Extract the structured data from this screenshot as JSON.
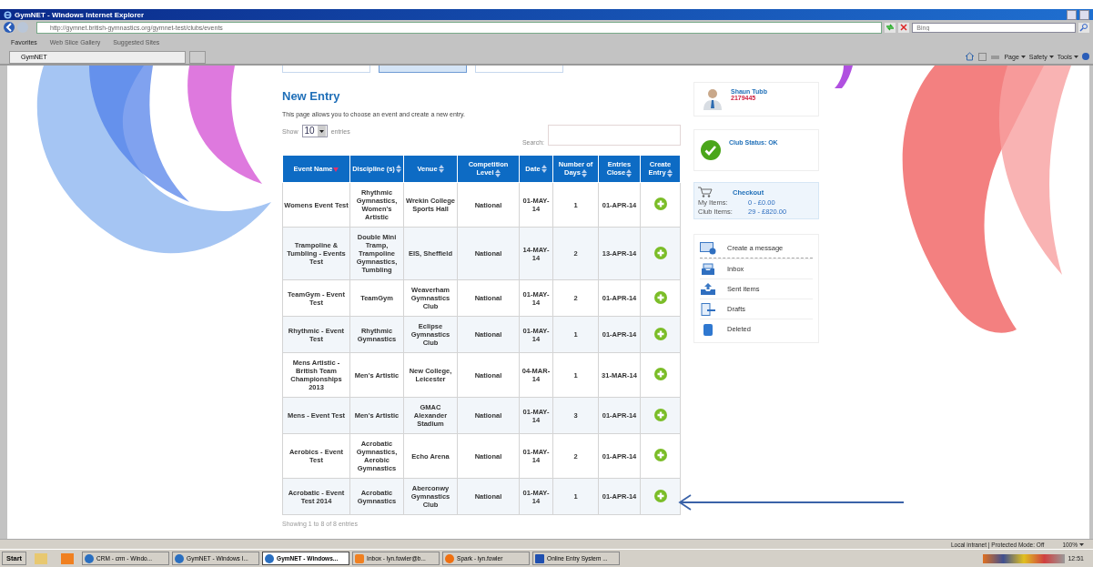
{
  "window": {
    "title": "GymNET - Windows Internet Explorer"
  },
  "address_bar": {
    "url": "http://gymnet.british-gymnastics.org/gymnet-test/clubs/events",
    "search_placeholder": "Bing"
  },
  "favorites_bar": {
    "favorites": "Favorites",
    "links": [
      "Web Slice Gallery",
      "Suggested Sites"
    ]
  },
  "tab_bar": {
    "tabs": [
      {
        "label": "GymNET",
        "selected": true
      }
    ],
    "commands": [
      "Page",
      "Safety",
      "Tools"
    ]
  },
  "page_tabs": [
    {
      "selected": false
    },
    {
      "selected": true
    },
    {
      "selected": false
    }
  ],
  "page": {
    "heading": "New Entry",
    "description": "This page allows you to choose an event and create a new entry.",
    "show_label": "Show",
    "page_size": "10",
    "entries_label": "entries",
    "search_label": "Search:",
    "footer": "Showing 1 to 8 of 8 entries"
  },
  "table": {
    "columns": [
      {
        "label": "Event Name",
        "sorted": true
      },
      {
        "label": "Discipline (s)",
        "sorted": false
      },
      {
        "label": "Venue",
        "sorted": false
      },
      {
        "label": "Competition Level",
        "sorted": false
      },
      {
        "label": "Date",
        "sorted": false
      },
      {
        "label": "Number of Days",
        "sorted": false
      },
      {
        "label": "Entries Close",
        "sorted": false
      },
      {
        "label": "Create Entry",
        "sorted": false
      }
    ],
    "rows": [
      {
        "cells": [
          "Womens Event Test",
          "Rhythmic Gymnastics, Women's Artistic",
          "Wrekin College Sports Hall",
          "National",
          "01-MAY-14",
          "1",
          "01-APR-14"
        ]
      },
      {
        "cells": [
          "Trampoline & Tumbling - Events Test",
          "Double Mini Tramp, Trampoline Gymnastics, Tumbling",
          "EIS, Sheffield",
          "National",
          "14-MAY-14",
          "2",
          "13-APR-14"
        ]
      },
      {
        "cells": [
          "TeamGym - Event Test",
          "TeamGym",
          "Weaverham Gymnastics Club",
          "National",
          "01-MAY-14",
          "2",
          "01-APR-14"
        ]
      },
      {
        "cells": [
          "Rhythmic - Event Test",
          "Rhythmic Gymnastics",
          "Eclipse Gymnastics Club",
          "National",
          "01-MAY-14",
          "1",
          "01-APR-14"
        ]
      },
      {
        "cells": [
          "Mens Artistic - British Team Championships 2013",
          "Men's Artistic",
          "New College, Leicester",
          "National",
          "04-MAR-14",
          "1",
          "31-MAR-14"
        ]
      },
      {
        "cells": [
          "Mens - Event Test",
          "Men's Artistic",
          "GMAC Alexander Stadium",
          "National",
          "01-MAY-14",
          "3",
          "01-APR-14"
        ]
      },
      {
        "cells": [
          "Aerobics - Event Test",
          "Acrobatic Gymnastics, Aerobic Gymnastics",
          "Echo Arena",
          "National",
          "01-MAY-14",
          "2",
          "01-APR-14"
        ]
      },
      {
        "cells": [
          "Acrobatic - Event Test 2014",
          "Acrobatic Gymnastics",
          "Aberconwy Gymnastics Club",
          "National",
          "01-MAY-14",
          "1",
          "01-APR-14"
        ]
      }
    ]
  },
  "sidebar": {
    "user": {
      "name": "Shaun Tubb",
      "number": "2179445"
    },
    "club_status": "Club Status: OK",
    "checkout": {
      "title": "Checkout",
      "lines": [
        {
          "label": "My Items:",
          "value": "0  -  £0.00"
        },
        {
          "label": "Club Items:",
          "value": "29  -  £820.00"
        }
      ]
    },
    "messages": [
      {
        "label": "Create a message",
        "kind": "create"
      },
      {
        "label": "Inbox",
        "kind": "inbox"
      },
      {
        "label": "Sent items",
        "kind": "sent"
      },
      {
        "label": "Drafts",
        "kind": "drafts"
      },
      {
        "label": "Deleted",
        "kind": "deleted"
      }
    ]
  },
  "status_bar": {
    "zone": "Local intranet | Protected Mode: Off",
    "zoom": "100%"
  },
  "taskbar": {
    "start": "Start",
    "items": [
      {
        "label": "CRM - crm  - Windo...",
        "selected": false,
        "kind": "ie"
      },
      {
        "label": "GymNET - Windows I...",
        "selected": false,
        "kind": "ie"
      },
      {
        "label": "GymNET - Windows...",
        "selected": true,
        "kind": "ie"
      },
      {
        "label": "Inbox - lyn.fowler@b...",
        "selected": false,
        "kind": "mail"
      },
      {
        "label": "Spark - lyn.fowler",
        "selected": false,
        "kind": "spark"
      },
      {
        "label": "Online Entry System ...",
        "selected": false,
        "kind": "word"
      }
    ],
    "clock": "12:51"
  }
}
